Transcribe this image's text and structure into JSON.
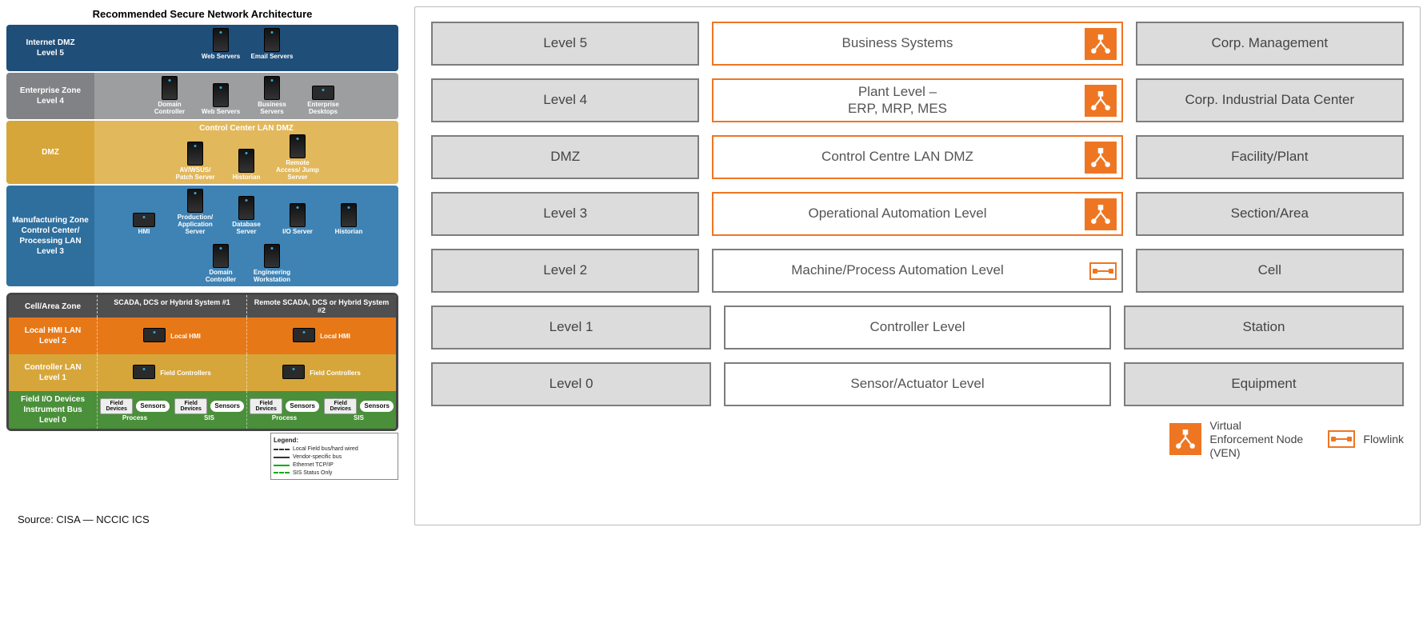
{
  "left": {
    "title": "Recommended Secure Network Architecture",
    "zones": [
      {
        "label": "Internet DMZ\nLevel 5",
        "bg": "#1f4e79",
        "body_bg": "#1f4e79",
        "devices": [
          "Web Servers",
          "Email Servers"
        ]
      },
      {
        "label": "Enterprise Zone\nLevel 4",
        "bg": "#808285",
        "body_bg": "#9c9ea0",
        "devices": [
          "Domain Controller",
          "Web Servers",
          "Business Servers",
          "Enterprise Desktops"
        ]
      },
      {
        "label": "DMZ",
        "bg": "#d7a63a",
        "body_bg": "#e2b85c",
        "subtitle": "Control Center LAN DMZ",
        "devices": [
          "AV/WSUS/ Patch Server",
          "Historian",
          "Remote Access/ Jump Server"
        ]
      },
      {
        "label": "Manufacturing Zone\nControl Center/ Processing LAN\nLevel 3",
        "bg": "#2e6f9e",
        "body_bg": "#3f83b4",
        "devices": [
          "HMI",
          "Production/ Application Server",
          "Database Server",
          "I/O Server",
          "Historian",
          "Domain Controller",
          "Engineering Workstation"
        ]
      }
    ],
    "subzones": {
      "header_label": "Cell/Area Zone",
      "system_a": "SCADA, DCS or Hybrid System #1",
      "system_b": "Remote SCADA, DCS or Hybrid System #2",
      "rows": [
        {
          "label": "Local HMI LAN\nLevel 2",
          "bg": "#e77817",
          "content": "Local HMI"
        },
        {
          "label": "Controller LAN\nLevel 1",
          "bg": "#d7a63a",
          "content": "Field Controllers"
        },
        {
          "label": "Field I/O Devices\nInstrument Bus\nLevel 0",
          "bg": "#4a8f3a",
          "content_items": [
            "Field Devices",
            "Sensors",
            "Process",
            "SIS"
          ]
        }
      ]
    },
    "legend": {
      "title": "Legend:",
      "items": [
        "Local Field bus/hard wired",
        "Vendor-specific bus",
        "Ethernet TCP/IP",
        "SIS Status Only"
      ]
    },
    "source": "Source: CISA — NCCIC ICS"
  },
  "right": {
    "rows": [
      {
        "level": "Level 5",
        "mid": "Business Systems",
        "mid_style": "orange",
        "icon": "ven",
        "right": "Corp. Management"
      },
      {
        "level": "Level 4",
        "mid": "Plant Level –\nERP, MRP, MES",
        "mid_style": "orange",
        "icon": "ven",
        "right": "Corp. Industrial Data Center"
      },
      {
        "level": "DMZ",
        "mid": "Control Centre LAN DMZ",
        "mid_style": "orange",
        "icon": "ven",
        "right": "Facility/Plant"
      },
      {
        "level": "Level 3",
        "mid": "Operational Automation Level",
        "mid_style": "orange",
        "icon": "ven",
        "right": "Section/Area"
      },
      {
        "level": "Level 2",
        "mid": "Machine/Process Automation Level",
        "mid_style": "plain",
        "icon": "flow",
        "right": "Cell"
      },
      {
        "level": "Level 1",
        "mid": "Controller Level",
        "mid_style": "plain",
        "icon": "none",
        "right": "Station"
      },
      {
        "level": "Level 0",
        "mid": "Sensor/Actuator Level",
        "mid_style": "plain",
        "icon": "none",
        "right": "Equipment"
      }
    ],
    "legend": {
      "ven": "Virtual Enforcement Node (VEN)",
      "flow": "Flowlink"
    }
  }
}
